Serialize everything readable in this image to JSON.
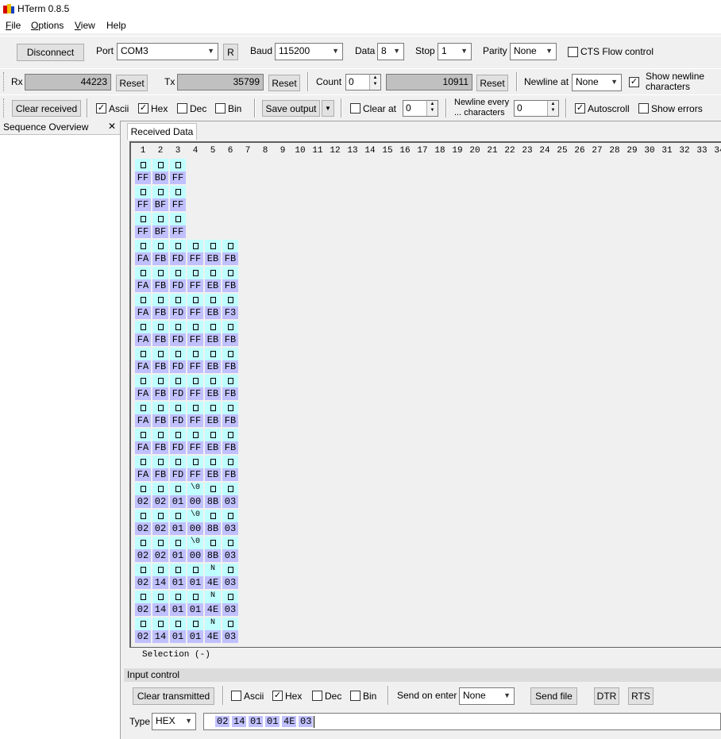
{
  "window": {
    "title": "HTerm 0.8.5"
  },
  "menu": [
    {
      "label": "File",
      "key": "F",
      "rest": "ile"
    },
    {
      "label": "Options",
      "key": "O",
      "rest": "ptions"
    },
    {
      "label": "View",
      "key": "V",
      "rest": "iew"
    },
    {
      "label": "Help",
      "key": "",
      "rest": "Help"
    }
  ],
  "connection": {
    "disconnect_label": "Disconnect",
    "port_label": "Port",
    "port_value": "COM3",
    "r_label": "R",
    "baud_label": "Baud",
    "baud_value": "115200",
    "data_label": "Data",
    "data_value": "8",
    "stop_label": "Stop",
    "stop_value": "1",
    "parity_label": "Parity",
    "parity_value": "None",
    "cts_label": "CTS Flow control",
    "cts_checked": false
  },
  "counters": {
    "rx_label": "Rx",
    "rx_value": "44223",
    "rx_reset": "Reset",
    "tx_label": "Tx",
    "tx_value": "35799",
    "tx_reset": "Reset",
    "count_label": "Count",
    "count_value": "0",
    "count_total": "10911",
    "count_reset": "Reset",
    "newline_at_label": "Newline at",
    "newline_at_value": "None",
    "show_newline_label_1": "Show newline",
    "show_newline_label_2": "characters",
    "show_newline_checked": true
  },
  "receive_options": {
    "clear_received": "Clear received",
    "ascii_label": "Ascii",
    "hex_label": "Hex",
    "dec_label": "Dec",
    "bin_label": "Bin",
    "save_output": "Save output",
    "clear_at_label": "Clear at",
    "clear_at_value": "0",
    "newline_every_1": "Newline every",
    "newline_every_2": "... characters",
    "newline_every_value": "0",
    "autoscroll_label": "Autoscroll",
    "show_errors_label": "Show errors"
  },
  "sequence_overview": {
    "title": "Sequence Overview",
    "close": "✕"
  },
  "received": {
    "tab_label": "Received Data",
    "ruler": [
      "1",
      "2",
      "3",
      "4",
      "5",
      "6",
      "7",
      "8",
      "9",
      "10",
      "11",
      "12",
      "13",
      "14",
      "15",
      "16",
      "17",
      "18",
      "19",
      "20",
      "21",
      "22",
      "23",
      "24",
      "25",
      "26",
      "27",
      "28",
      "29",
      "30",
      "31",
      "32",
      "33",
      "34"
    ],
    "rows": [
      [
        [
          "□",
          "FF"
        ],
        [
          "□",
          "BD"
        ],
        [
          "□",
          "FF"
        ]
      ],
      [
        [
          "□",
          "FF"
        ],
        [
          "□",
          "BF"
        ],
        [
          "□",
          "FF"
        ]
      ],
      [
        [
          "□",
          "FF"
        ],
        [
          "□",
          "BF"
        ],
        [
          "□",
          "FF"
        ]
      ],
      [
        [
          "□",
          "FA"
        ],
        [
          "□",
          "FB"
        ],
        [
          "□",
          "FD"
        ],
        [
          "□",
          "FF"
        ],
        [
          "□",
          "EB"
        ],
        [
          "□",
          "FB"
        ]
      ],
      [
        [
          "□",
          "FA"
        ],
        [
          "□",
          "FB"
        ],
        [
          "□",
          "FD"
        ],
        [
          "□",
          "FF"
        ],
        [
          "□",
          "EB"
        ],
        [
          "□",
          "FB"
        ]
      ],
      [
        [
          "□",
          "FA"
        ],
        [
          "□",
          "FB"
        ],
        [
          "□",
          "FD"
        ],
        [
          "□",
          "FF"
        ],
        [
          "□",
          "EB"
        ],
        [
          "□",
          "F3"
        ]
      ],
      [
        [
          "□",
          "FA"
        ],
        [
          "□",
          "FB"
        ],
        [
          "□",
          "FD"
        ],
        [
          "□",
          "FF"
        ],
        [
          "□",
          "EB"
        ],
        [
          "□",
          "FB"
        ]
      ],
      [
        [
          "□",
          "FA"
        ],
        [
          "□",
          "FB"
        ],
        [
          "□",
          "FD"
        ],
        [
          "□",
          "FF"
        ],
        [
          "□",
          "EB"
        ],
        [
          "□",
          "FB"
        ]
      ],
      [
        [
          "□",
          "FA"
        ],
        [
          "□",
          "FB"
        ],
        [
          "□",
          "FD"
        ],
        [
          "□",
          "FF"
        ],
        [
          "□",
          "EB"
        ],
        [
          "□",
          "FB"
        ]
      ],
      [
        [
          "□",
          "FA"
        ],
        [
          "□",
          "FB"
        ],
        [
          "□",
          "FD"
        ],
        [
          "□",
          "FF"
        ],
        [
          "□",
          "EB"
        ],
        [
          "□",
          "FB"
        ]
      ],
      [
        [
          "□",
          "FA"
        ],
        [
          "□",
          "FB"
        ],
        [
          "□",
          "FD"
        ],
        [
          "□",
          "FF"
        ],
        [
          "□",
          "EB"
        ],
        [
          "□",
          "FB"
        ]
      ],
      [
        [
          "□",
          "FA"
        ],
        [
          "□",
          "FB"
        ],
        [
          "□",
          "FD"
        ],
        [
          "□",
          "FF"
        ],
        [
          "□",
          "EB"
        ],
        [
          "□",
          "FB"
        ]
      ],
      [
        [
          "□",
          "02"
        ],
        [
          "□",
          "02"
        ],
        [
          "□",
          "01"
        ],
        [
          "\\0",
          "00"
        ],
        [
          "□",
          "8B"
        ],
        [
          "□",
          "03"
        ]
      ],
      [
        [
          "□",
          "02"
        ],
        [
          "□",
          "02"
        ],
        [
          "□",
          "01"
        ],
        [
          "\\0",
          "00"
        ],
        [
          "□",
          "8B"
        ],
        [
          "□",
          "03"
        ]
      ],
      [
        [
          "□",
          "02"
        ],
        [
          "□",
          "02"
        ],
        [
          "□",
          "01"
        ],
        [
          "\\0",
          "00"
        ],
        [
          "□",
          "8B"
        ],
        [
          "□",
          "03"
        ]
      ],
      [
        [
          "□",
          "02"
        ],
        [
          "□",
          "14"
        ],
        [
          "□",
          "01"
        ],
        [
          "□",
          "01"
        ],
        [
          "N",
          "4E"
        ],
        [
          "□",
          "03"
        ]
      ],
      [
        [
          "□",
          "02"
        ],
        [
          "□",
          "14"
        ],
        [
          "□",
          "01"
        ],
        [
          "□",
          "01"
        ],
        [
          "N",
          "4E"
        ],
        [
          "□",
          "03"
        ]
      ],
      [
        [
          "□",
          "02"
        ],
        [
          "□",
          "14"
        ],
        [
          "□",
          "01"
        ],
        [
          "□",
          "01"
        ],
        [
          "N",
          "4E"
        ],
        [
          "□",
          "03"
        ]
      ]
    ],
    "selection": "Selection (-)"
  },
  "input_control": {
    "header": "Input control",
    "clear_transmitted": "Clear transmitted",
    "ascii_label": "Ascii",
    "hex_label": "Hex",
    "dec_label": "Dec",
    "bin_label": "Bin",
    "send_on_enter_label": "Send on enter",
    "send_on_enter_value": "None",
    "send_file": "Send file",
    "dtr": "DTR",
    "rts": "RTS",
    "type_label": "Type",
    "type_value": "HEX",
    "bytes": [
      "02",
      "14",
      "01",
      "01",
      "4E",
      "03"
    ]
  },
  "colors": {
    "ascii_bg": "#c0ffff",
    "hex_bg": "#c0c0ff"
  }
}
